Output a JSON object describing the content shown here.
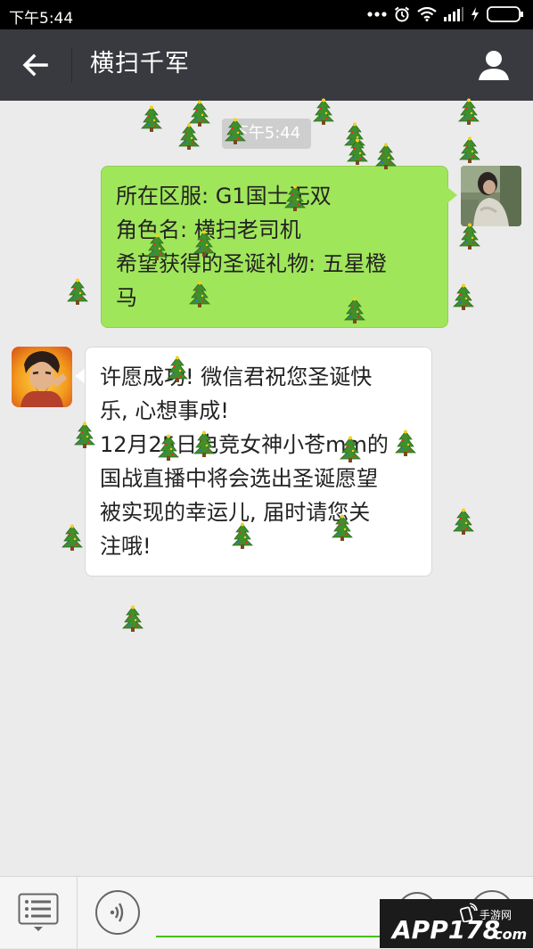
{
  "status_bar": {
    "time": "下午5:44"
  },
  "header": {
    "title": "横扫千军"
  },
  "messages": {
    "timestamp": "下午5:44",
    "sent": {
      "lines": [
        "所在区服: G1国士无双",
        "角色名: 横扫老司机",
        "希望获得的圣诞礼物: 五星橙",
        "马"
      ]
    },
    "received": {
      "lines": [
        "许愿成功! 微信君祝您圣诞快",
        "乐, 心想事成!",
        "12月25日电竞女神小苍mm的",
        "国战直播中将会选出圣诞愿望",
        "被实现的幸运儿, 届时请您关",
        "注哦!"
      ]
    }
  },
  "input_bar": {
    "text_value": ""
  },
  "watermark": {
    "brand": "APP178",
    "label": "手游网",
    "domain": ".com"
  },
  "icons": {
    "back": "arrow-left",
    "profile": "person",
    "menu": "list-menu",
    "voice": "voice-wave",
    "emoji": "smiley",
    "plus": "plus",
    "decoration": "christmas-tree"
  },
  "colors": {
    "title_bar": "#393a3f",
    "outgoing_bubble": "#a0e65a",
    "incoming_bubble": "#ffffff",
    "chat_background": "#ebebeb",
    "input_underline": "#45c01a"
  }
}
